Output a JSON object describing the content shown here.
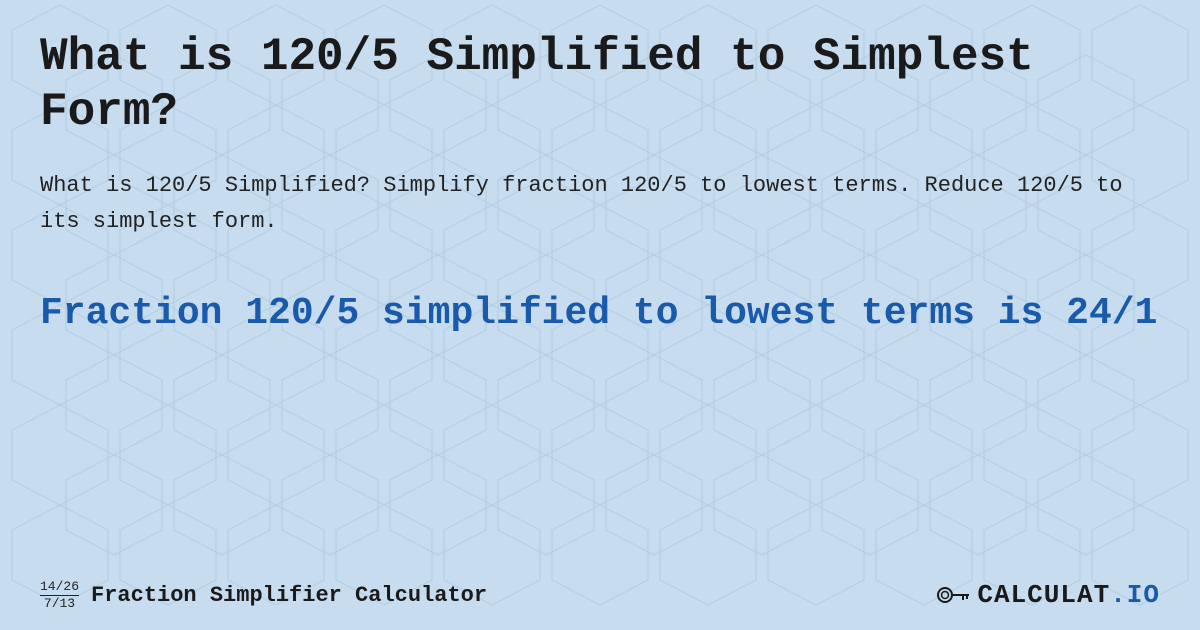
{
  "background": {
    "color": "#c8dcf0"
  },
  "header": {
    "title": "What is 120/5 Simplified to Simplest Form?"
  },
  "description": {
    "text": "What is 120/5 Simplified? Simplify fraction 120/5 to lowest terms. Reduce 120/5 to its simplest form."
  },
  "result": {
    "title": "Fraction 120/5 simplified to lowest terms is 24/1"
  },
  "footer": {
    "fraction1": {
      "numerator": "14/26",
      "denominator": "7/13"
    },
    "brand_label": "Fraction Simplifier Calculator",
    "logo_text": "CALCULAT.IO"
  }
}
